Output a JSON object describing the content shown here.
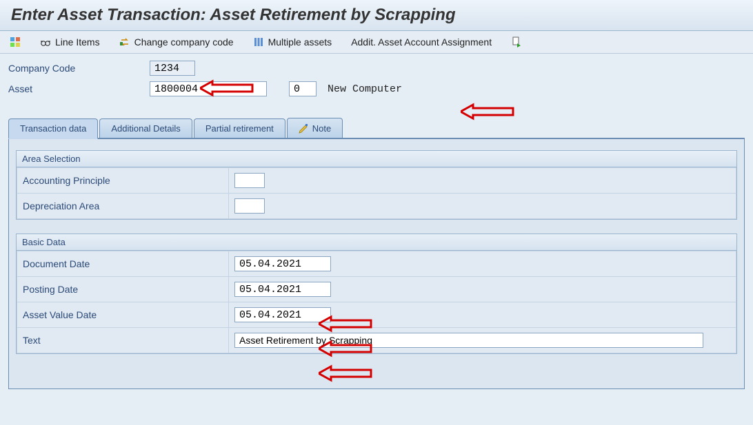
{
  "title": "Enter Asset Transaction: Asset Retirement by Scrapping",
  "toolbar": {
    "line_items": "Line Items",
    "change_company_code": "Change company code",
    "multiple_assets": "Multiple assets",
    "addit_asset_acct": "Addit. Asset Account Assignment"
  },
  "header": {
    "company_code_label": "Company Code",
    "company_code_value": "1234",
    "asset_label": "Asset",
    "asset_main": "1800004",
    "asset_sub": "0",
    "asset_desc": "New Computer"
  },
  "tabs": {
    "transaction_data": "Transaction data",
    "additional_details": "Additional Details",
    "partial_retirement": "Partial retirement",
    "note": "Note"
  },
  "area_selection": {
    "title": "Area Selection",
    "accounting_principle_label": "Accounting Principle",
    "accounting_principle_value": "",
    "depreciation_area_label": "Depreciation Area",
    "depreciation_area_value": ""
  },
  "basic_data": {
    "title": "Basic Data",
    "document_date_label": "Document Date",
    "document_date_value": "05.04.2021",
    "posting_date_label": "Posting Date",
    "posting_date_value": "05.04.2021",
    "asset_value_date_label": "Asset Value Date",
    "asset_value_date_value": "05.04.2021",
    "text_label": "Text",
    "text_value": "Asset Retirement by Scrapping"
  }
}
